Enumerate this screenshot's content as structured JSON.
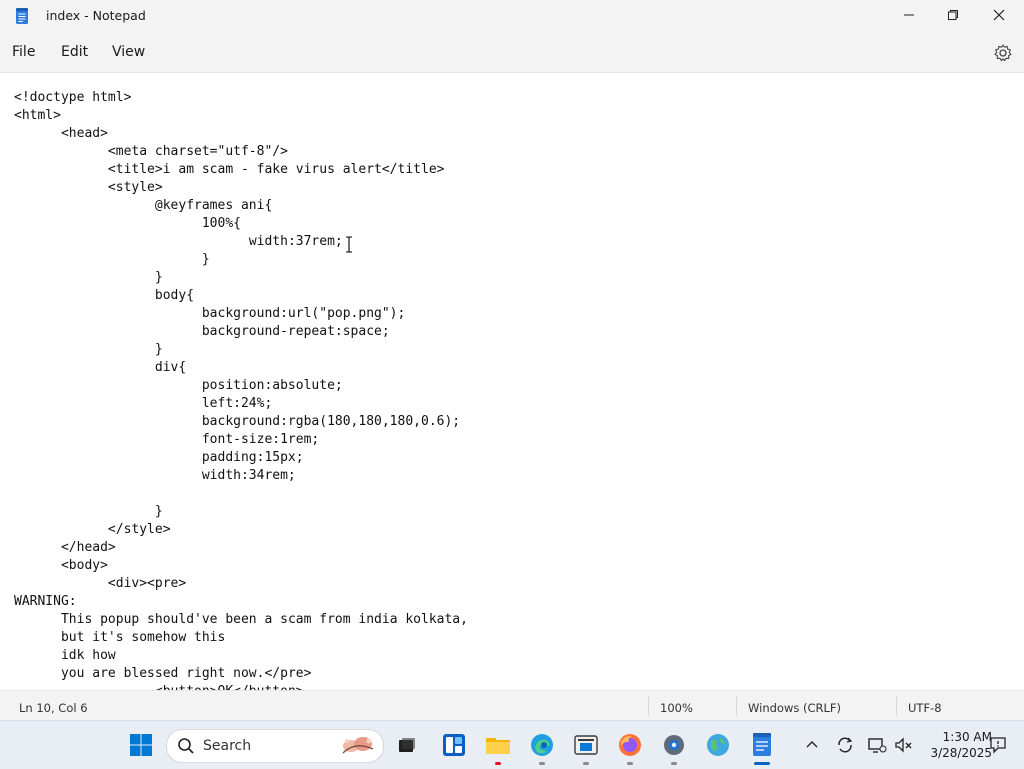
{
  "window": {
    "title": "index - Notepad"
  },
  "menu": {
    "file": "File",
    "edit": "Edit",
    "view": "View"
  },
  "editor": {
    "content": "<!doctype html>\n<html>\n\t<head>\n\t\t<meta charset=\"utf-8\"/>\n\t\t<title>i am scam - fake virus alert</title>\n\t\t<style>\n\t\t\t@keyframes ani{\n\t\t\t\t100%{\n\t\t\t\t\twidth:37rem;\n\t\t\t\t}\n\t\t\t}\n\t\t\tbody{\n\t\t\t\tbackground:url(\"pop.png\");\n\t\t\t\tbackground-repeat:space;\n\t\t\t}\n\t\t\tdiv{\n\t\t\t\tposition:absolute;\n\t\t\t\tleft:24%;\n\t\t\t\tbackground:rgba(180,180,180,0.6);\n\t\t\t\tfont-size:1rem;\n\t\t\t\tpadding:15px;\n\t\t\t\twidth:34rem;\n\n\t\t\t}\n\t\t</style>\n\t</head>\n\t<body>\n\t\t<div><pre>\nWARNING:\n\tThis popup should've been a scam from india kolkata,\n\tbut it's somehow this\n\tidk how\n\tyou are blessed right now.</pre>\n\t\t\t<button>OK</button>"
  },
  "status": {
    "position": "Ln 10, Col 6",
    "zoom": "100%",
    "line_ending": "Windows (CRLF)",
    "encoding": "UTF-8"
  },
  "taskbar": {
    "search_label": "Search",
    "time": "1:30 AM",
    "date": "3/28/2025",
    "pinned": [
      "start-icon",
      "search-icon",
      "task-view-icon",
      "widgets-icon",
      "file-explorer-icon",
      "edge-icon",
      "store-icon",
      "firefox-icon",
      "settings-icon",
      "globe-icon",
      "notepad-icon"
    ],
    "accent": "#0067c0",
    "running_indicator": "#e81123"
  }
}
